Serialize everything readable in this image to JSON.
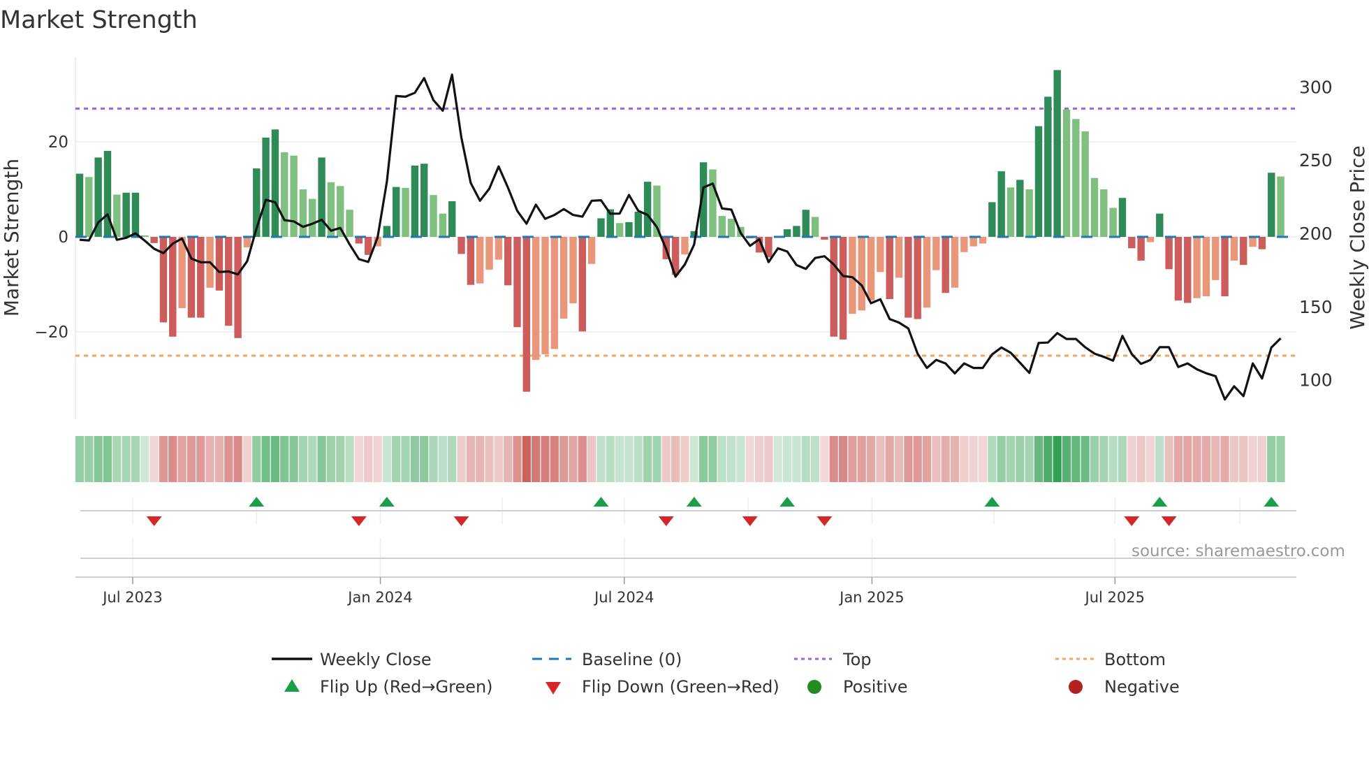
{
  "title": "Market Strength",
  "source": "source: sharemaestro.com",
  "colors": {
    "bar_pos_strong": "#2e8b57",
    "bar_pos_weak": "#7fbf7f",
    "bar_neg_strong": "#cd5c5c",
    "bar_neg_weak": "#e9967a",
    "price_line": "#111111",
    "baseline": "#1f77b4",
    "top": "#9966dd",
    "bottom": "#f4a460",
    "flip_up": "#1a9e4a",
    "flip_down": "#d62728",
    "positive": "#228b22",
    "negative": "#b22222",
    "heat_green": "#2e9e4f",
    "heat_red": "#c75450"
  },
  "chart_data": {
    "type": "bar",
    "title": "Market Strength",
    "ylabel": "Market Strength",
    "y2label": "Weekly Close Price",
    "ylim": [
      -38,
      40
    ],
    "y2lim": [
      80,
      320
    ],
    "yticks": [
      {
        "v": 20,
        "label": "20"
      },
      {
        "v": 0,
        "label": "0"
      },
      {
        "v": -20,
        "label": "−20"
      }
    ],
    "y2ticks": [
      {
        "v": 300,
        "label": "300"
      },
      {
        "v": 250,
        "label": "250"
      },
      {
        "v": 200,
        "label": "200"
      },
      {
        "v": 150,
        "label": "150"
      },
      {
        "v": 100,
        "label": "100"
      }
    ],
    "xticks": [
      {
        "week": 6.7,
        "label": "Jul 2023"
      },
      {
        "week": 33.3,
        "label": "Jan 2024"
      },
      {
        "week": 59.5,
        "label": "Jul 2024"
      },
      {
        "week": 86.1,
        "label": "Jan 2025"
      },
      {
        "week": 112.2,
        "label": "Jul 2025"
      }
    ],
    "minor_grid_weeks": [
      20,
      46.4,
      72.8,
      99.2,
      125.6
    ],
    "baseline": 0,
    "top": 27,
    "bottom": -25,
    "strength": [
      13.3,
      12.6,
      16.7,
      18.1,
      8.9,
      9.3,
      9.3,
      0.3,
      -1.3,
      -18,
      -21,
      -15,
      -17,
      -17,
      -10.7,
      -11.3,
      -18.7,
      -21.3,
      -2.2,
      14.4,
      20.9,
      22.6,
      17.8,
      17.1,
      10,
      8,
      16.7,
      11.5,
      10.7,
      5.7,
      -1.4,
      -3.8,
      -2,
      2.3,
      10.5,
      10.3,
      15,
      15.4,
      8.8,
      4.9,
      7.5,
      -3.6,
      -10.1,
      -9.8,
      -6.9,
      -4.8,
      -10.2,
      -19,
      -32.6,
      -25.9,
      -24.7,
      -23.6,
      -17.2,
      -14,
      -19.9,
      -5.7,
      3.9,
      5.8,
      2.9,
      3.1,
      5.3,
      11.6,
      10.8,
      -4.7,
      -8,
      -3.7,
      1.2,
      15.7,
      14.2,
      4.4,
      3.8,
      2.1,
      -0.3,
      -3.3,
      -4.3,
      0,
      1.6,
      2.3,
      5.7,
      4.2,
      -0.6,
      -21,
      -21.6,
      -16.2,
      -15.5,
      -13.4,
      -7.4,
      -13.1,
      -8.6,
      -17,
      -17.3,
      -14.9,
      -7,
      -11.8,
      -10.7,
      -3.2,
      -2,
      -1.4,
      7.3,
      13.8,
      10.4,
      12,
      10,
      23.3,
      29.5,
      35.1,
      26.8,
      24.8,
      22.2,
      12.4,
      10,
      6.1,
      8.2,
      -2.4,
      -5,
      -1.1,
      4.9,
      -6.8,
      -13.4,
      -13.9,
      -12.9,
      -12.5,
      -9.1,
      -12.5,
      -5,
      -5.9,
      -2.1,
      -2.6,
      13.5,
      12.7
    ],
    "weekly_close": [
      195.6,
      195.2,
      207.5,
      213,
      195.6,
      197,
      200,
      195,
      189.5,
      186.5,
      193,
      196.5,
      182.8,
      180.3,
      180.3,
      173.6,
      174,
      172,
      181,
      203.5,
      222.9,
      221.3,
      209,
      208.2,
      204.5,
      206.6,
      209.3,
      201.8,
      203.7,
      192.4,
      182.4,
      180.5,
      197.2,
      235.3,
      293.8,
      293.3,
      296,
      306,
      291,
      283.8,
      308.4,
      265.5,
      234.5,
      222.3,
      230.5,
      245.7,
      231.3,
      215.4,
      206.6,
      219.6,
      209.9,
      212.6,
      216.6,
      212.6,
      211.4,
      222.3,
      222.6,
      213.4,
      213.5,
      226.2,
      215.4,
      212.6,
      204.3,
      189.2,
      170.4,
      178.8,
      192.4,
      231.3,
      234,
      217,
      216.2,
      200.3,
      191.5,
      196,
      180.4,
      189.8,
      187.6,
      178.4,
      175.7,
      183.2,
      184.4,
      178.8,
      170.9,
      170.1,
      164.5,
      152.3,
      155,
      141.5,
      139.1,
      135.1,
      117.9,
      108.1,
      113.6,
      111.2,
      104.4,
      111.2,
      108.1,
      108.1,
      117.3,
      122.1,
      118.5,
      111.7,
      104.7,
      125.2,
      125.5,
      131.9,
      127.9,
      127.9,
      122.3,
      117.9,
      115.7,
      113.1,
      130,
      117.6,
      110.9,
      113.6,
      122.3,
      122.3,
      108.8,
      111.2,
      107.2,
      104.5,
      102.5,
      86.6,
      95.6,
      88.9,
      111.2,
      100.9,
      122.1,
      128.4
    ],
    "flip_up_weeks": [
      20,
      34,
      57,
      67,
      77,
      99,
      117,
      129
    ],
    "flip_down_weeks": [
      9,
      31,
      42,
      64,
      73,
      81,
      114,
      118
    ],
    "legend": {
      "weekly_close": "Weekly Close",
      "baseline": "Baseline (0)",
      "top": "Top",
      "bottom": "Bottom",
      "flip_up": "Flip Up (Red→Green)",
      "flip_down": "Flip Down (Green→Red)",
      "positive": "Positive",
      "negative": "Negative"
    },
    "legend_placement": "bottom"
  }
}
